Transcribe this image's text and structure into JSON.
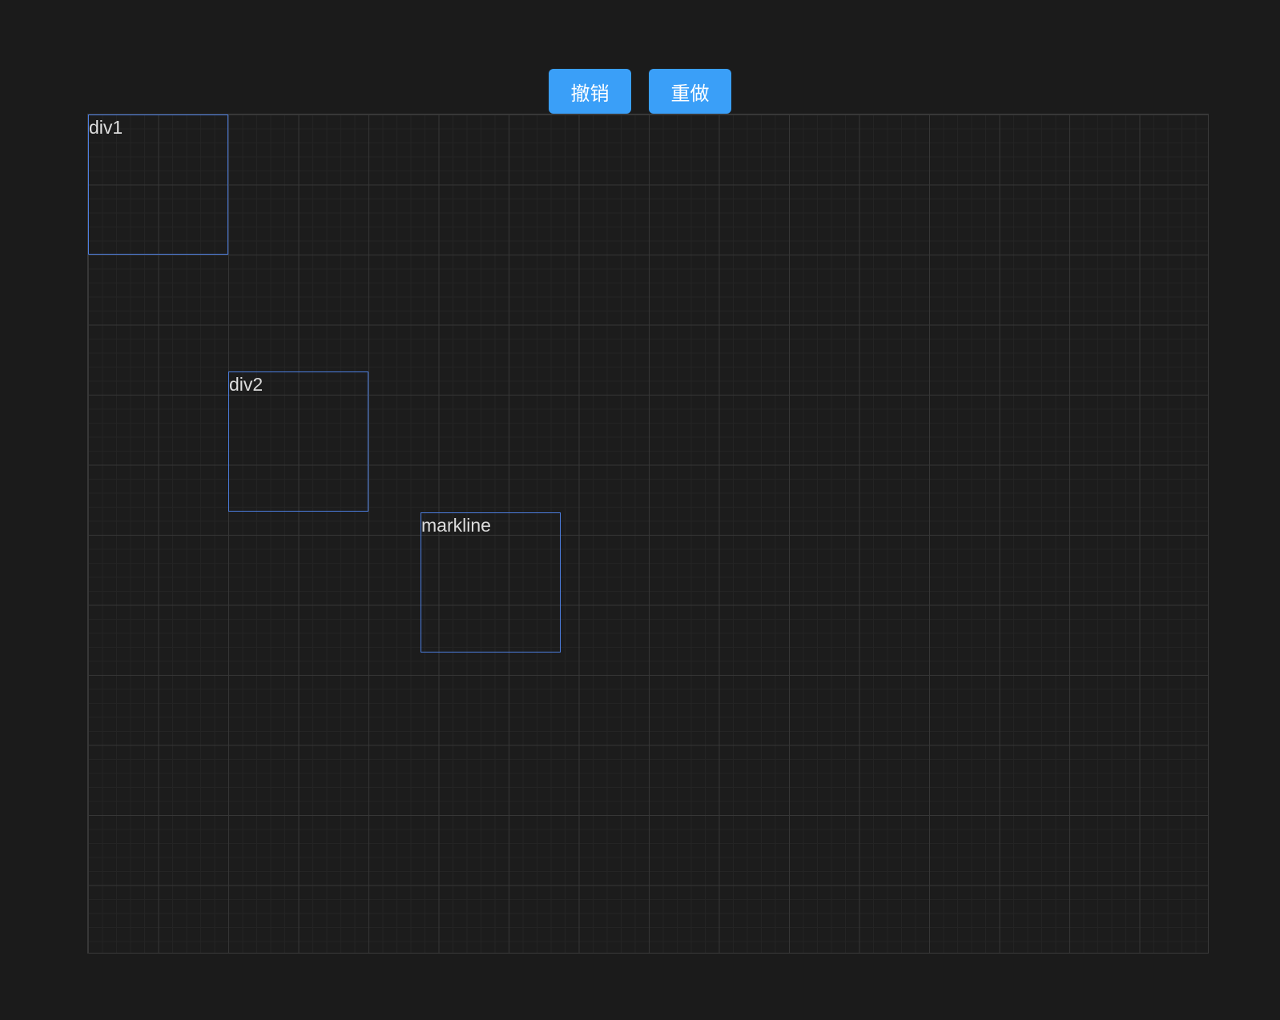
{
  "toolbar": {
    "undo_label": "撤销",
    "redo_label": "重做",
    "button_color": "#3a9ff8"
  },
  "canvas": {
    "background_color": "#1c1c1c",
    "grid": true,
    "block_border_color": "#4c7ee0",
    "blocks": [
      {
        "label": "div1"
      },
      {
        "label": "div2"
      },
      {
        "label": "markline"
      }
    ]
  }
}
